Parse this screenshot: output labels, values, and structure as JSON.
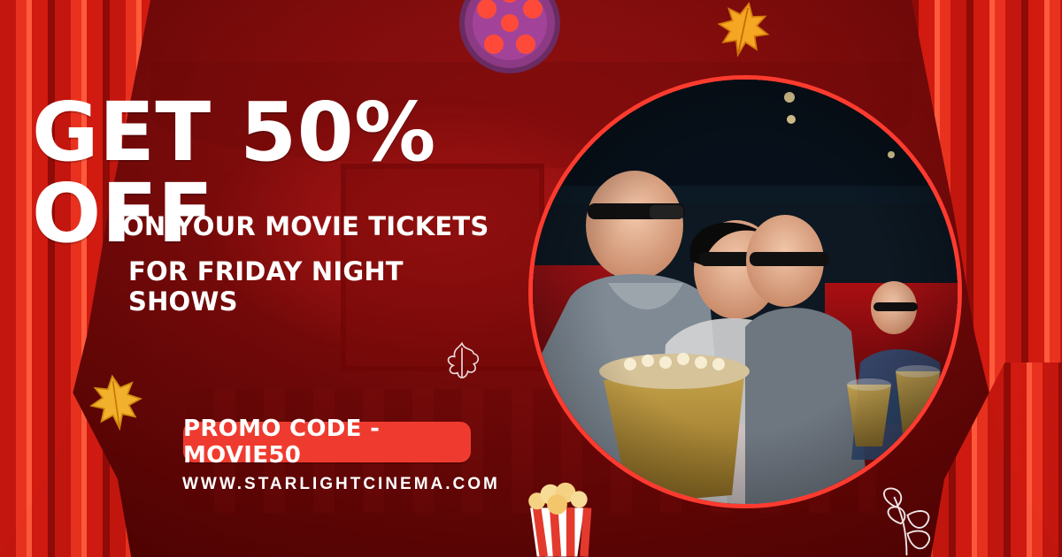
{
  "headline": "GET 50% OFF",
  "subheadline_1": "ON YOUR MOVIE TICKETS",
  "subheadline_2": "FOR FRIDAY NIGHT SHOWS",
  "promo_code_label": "PROMO CODE -MOVIE50",
  "website": "WWW.STARLIGHTCINEMA.COM",
  "colors": {
    "background": "#7a0b0b",
    "accent_red": "#ef3b2f",
    "ring_red": "#ff3b2f",
    "text": "#ffffff"
  },
  "decorations": {
    "film_reel_icon": "film-reel-icon",
    "autumn_leaf_icon": "autumn-leaf-icon",
    "outline_leaf_icon": "outline-leaf-icon",
    "popcorn_icon": "popcorn-icon",
    "plant_icon": "plant-icon"
  }
}
